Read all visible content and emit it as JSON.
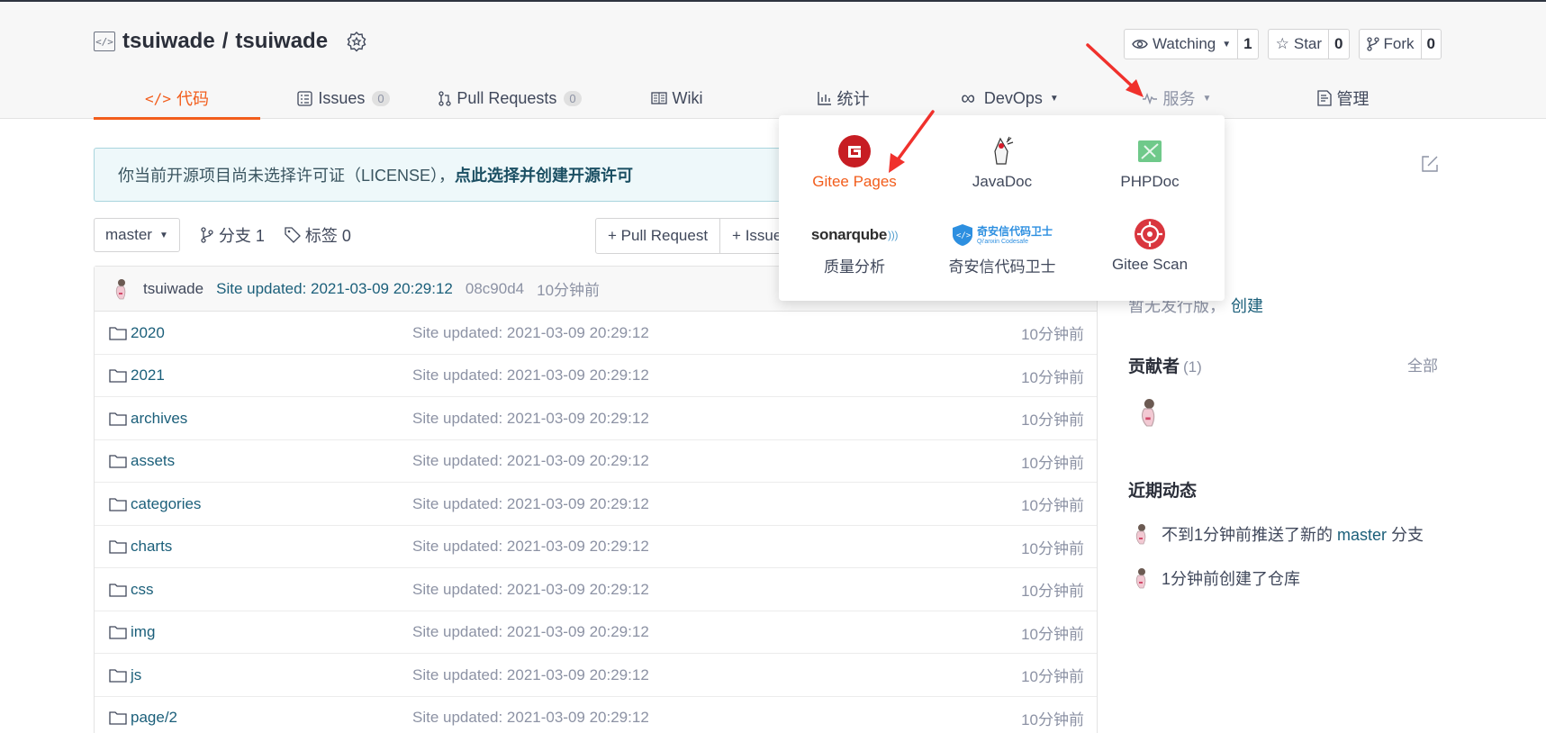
{
  "repo": {
    "owner": "tsuiwade",
    "separator": "/",
    "name": "tsuiwade"
  },
  "actions": {
    "watch_label": "Watching",
    "watch_count": "1",
    "star_label": "Star",
    "star_count": "0",
    "fork_label": "Fork",
    "fork_count": "0"
  },
  "tabs": [
    {
      "label": "代码",
      "icon": "code-icon",
      "active": true
    },
    {
      "label": "Issues",
      "icon": "issues-icon",
      "count": "0"
    },
    {
      "label": "Pull Requests",
      "icon": "pull-request-icon",
      "count": "0"
    },
    {
      "label": "Wiki",
      "icon": "wiki-icon"
    },
    {
      "label": "统计",
      "icon": "chart-icon"
    },
    {
      "label": "DevOps",
      "icon": "infinity-icon"
    },
    {
      "label": "服务",
      "icon": "pulse-icon"
    },
    {
      "label": "管理",
      "icon": "settings-doc-icon"
    }
  ],
  "notice": {
    "text": "你当前开源项目尚未选择许可证（LICENSE），",
    "link": "点此选择并创建开源许可"
  },
  "branchbar": {
    "branch": "master",
    "branches_label": "分支 1",
    "tags_label": "标签 0",
    "pr_button": "+ Pull Request",
    "issue_button": "+ Issue"
  },
  "commit": {
    "user": "tsuiwade",
    "message": "Site updated: 2021-03-09 20:29:12",
    "sha": "08c90d4",
    "time": "10分钟前"
  },
  "files": [
    {
      "name": "2020",
      "message": "Site updated: 2021-03-09 20:29:12",
      "time": "10分钟前"
    },
    {
      "name": "2021",
      "message": "Site updated: 2021-03-09 20:29:12",
      "time": "10分钟前"
    },
    {
      "name": "archives",
      "message": "Site updated: 2021-03-09 20:29:12",
      "time": "10分钟前"
    },
    {
      "name": "assets",
      "message": "Site updated: 2021-03-09 20:29:12",
      "time": "10分钟前"
    },
    {
      "name": "categories",
      "message": "Site updated: 2021-03-09 20:29:12",
      "time": "10分钟前"
    },
    {
      "name": "charts",
      "message": "Site updated: 2021-03-09 20:29:12",
      "time": "10分钟前"
    },
    {
      "name": "css",
      "message": "Site updated: 2021-03-09 20:29:12",
      "time": "10分钟前"
    },
    {
      "name": "img",
      "message": "Site updated: 2021-03-09 20:29:12",
      "time": "10分钟前"
    },
    {
      "name": "js",
      "message": "Site updated: 2021-03-09 20:29:12",
      "time": "10分钟前"
    },
    {
      "name": "page/2",
      "message": "Site updated: 2021-03-09 20:29:12",
      "time": "10分钟前"
    }
  ],
  "sidebar": {
    "release_text": "暂无发行版，",
    "release_link": "创建",
    "contributors_title": "贡献者",
    "contributors_count": "(1)",
    "contributors_all": "全部",
    "activity_title": "近期动态",
    "activities": [
      {
        "prefix": "不到1分钟前推送了新的 ",
        "highlight": "master",
        "suffix": " 分支"
      },
      {
        "prefix": "1分钟前创建了仓库",
        "highlight": "",
        "suffix": ""
      }
    ]
  },
  "services_menu": {
    "items": [
      {
        "label": "Gitee Pages",
        "icon": "gitee-pages-icon",
        "active": true
      },
      {
        "label": "JavaDoc",
        "icon": "javadoc-icon"
      },
      {
        "label": "PHPDoc",
        "icon": "phpdoc-icon"
      },
      {
        "label": "质量分析",
        "icon": "sonarqube-icon",
        "logo_text": "sonarqube"
      },
      {
        "label": "奇安信代码卫士",
        "icon": "qianxin-codesafe-icon",
        "logo_text": "奇安信代码卫士",
        "logo_subtext": "Qi'anxin Codesafe"
      },
      {
        "label": "Gitee Scan",
        "icon": "gitee-scan-icon"
      }
    ]
  },
  "colors": {
    "accent": "#f25d1c",
    "link": "#1b5f7a",
    "annotation_arrow": "#f0312c"
  }
}
